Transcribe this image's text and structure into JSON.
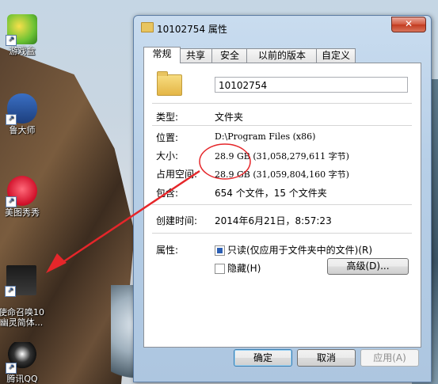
{
  "desktop": {
    "icons": [
      {
        "label": "游戏盒"
      },
      {
        "label": "鲁大师"
      },
      {
        "label": "美图秀秀"
      },
      {
        "label": "使命召唤10\n幽灵简体..."
      },
      {
        "label": "腾讯QQ"
      }
    ]
  },
  "window": {
    "title": "10102754 属性",
    "close_label": "✕",
    "tabs": [
      "常规",
      "共享",
      "安全",
      "以前的版本",
      "自定义"
    ],
    "active_tab": "常规",
    "name_value": "10102754",
    "fields": {
      "type_label": "类型:",
      "type_value": "文件夹",
      "location_label": "位置:",
      "location_value": "D:\\Program Files (x86)",
      "size_label": "大小:",
      "size_value": "28.9 GB (31,058,279,611 字节)",
      "size_on_disk_label": "占用空间:",
      "size_on_disk_value": "28.9 GB (31,059,804,160 字节)",
      "contains_label": "包含:",
      "contains_value": "654 个文件，15 个文件夹",
      "created_label": "创建时间:",
      "created_value": "2014年6月21日，8:57:23",
      "attributes_label": "属性:"
    },
    "attributes": {
      "readonly_label": "只读(仅应用于文件夹中的文件)(R)",
      "readonly_checked": true,
      "hidden_label": "隐藏(H)",
      "hidden_checked": false,
      "advanced_label": "高级(D)..."
    },
    "buttons": {
      "ok": "确定",
      "cancel": "取消",
      "apply": "应用(A)"
    }
  },
  "colors": {
    "annotation": "#e5262a"
  }
}
